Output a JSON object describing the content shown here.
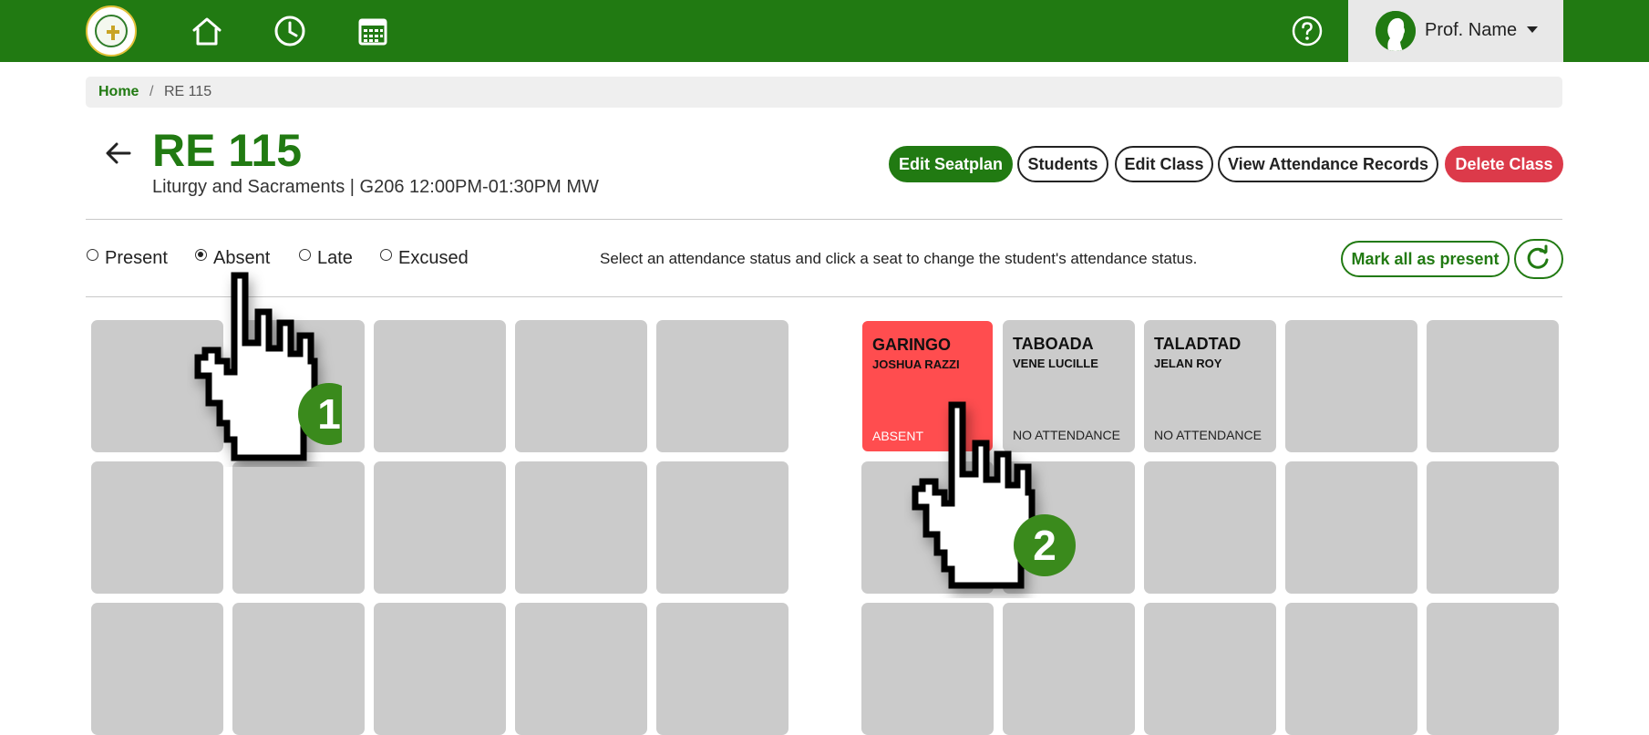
{
  "header": {
    "nav_icons": [
      "logo",
      "home-icon",
      "clock-icon",
      "calendar-icon"
    ],
    "help_icon": "question-circle-icon",
    "profile_name": "Prof. Name"
  },
  "breadcrumb": {
    "home": "Home",
    "separator": "/",
    "current": "RE 115"
  },
  "class": {
    "code": "RE 115",
    "details": "Liturgy and Sacraments | G206 12:00PM-01:30PM MW"
  },
  "actions": {
    "edit_seatplan": "Edit Seatplan",
    "students": "Students",
    "edit_class": "Edit Class",
    "view_records": "View Attendance Records",
    "delete_class": "Delete Class"
  },
  "attendance": {
    "options": [
      {
        "label": "Present",
        "checked": false
      },
      {
        "label": "Absent",
        "checked": true
      },
      {
        "label": "Late",
        "checked": false
      },
      {
        "label": "Excused",
        "checked": false
      }
    ],
    "hint": "Select an attendance status and click a seat to change the student's attendance status.",
    "mark_all": "Mark all as present"
  },
  "seats": {
    "s1": {
      "last": "GARINGO",
      "first": "JOSHUA RAZZI",
      "status": "ABSENT"
    },
    "s2": {
      "last": "TABOADA",
      "first": "VENE LUCILLE",
      "status": "NO ATTENDANCE"
    },
    "s3": {
      "last": "TALADTAD",
      "first": "JELAN ROY",
      "status": "NO ATTENDANCE"
    }
  },
  "callouts": {
    "one": "1",
    "two": "2"
  },
  "colors": {
    "brand_green": "#217a12",
    "absent_red": "#ff4d4f",
    "delete_red": "#dc3a4a",
    "seat_gray": "#cbcbcb"
  }
}
